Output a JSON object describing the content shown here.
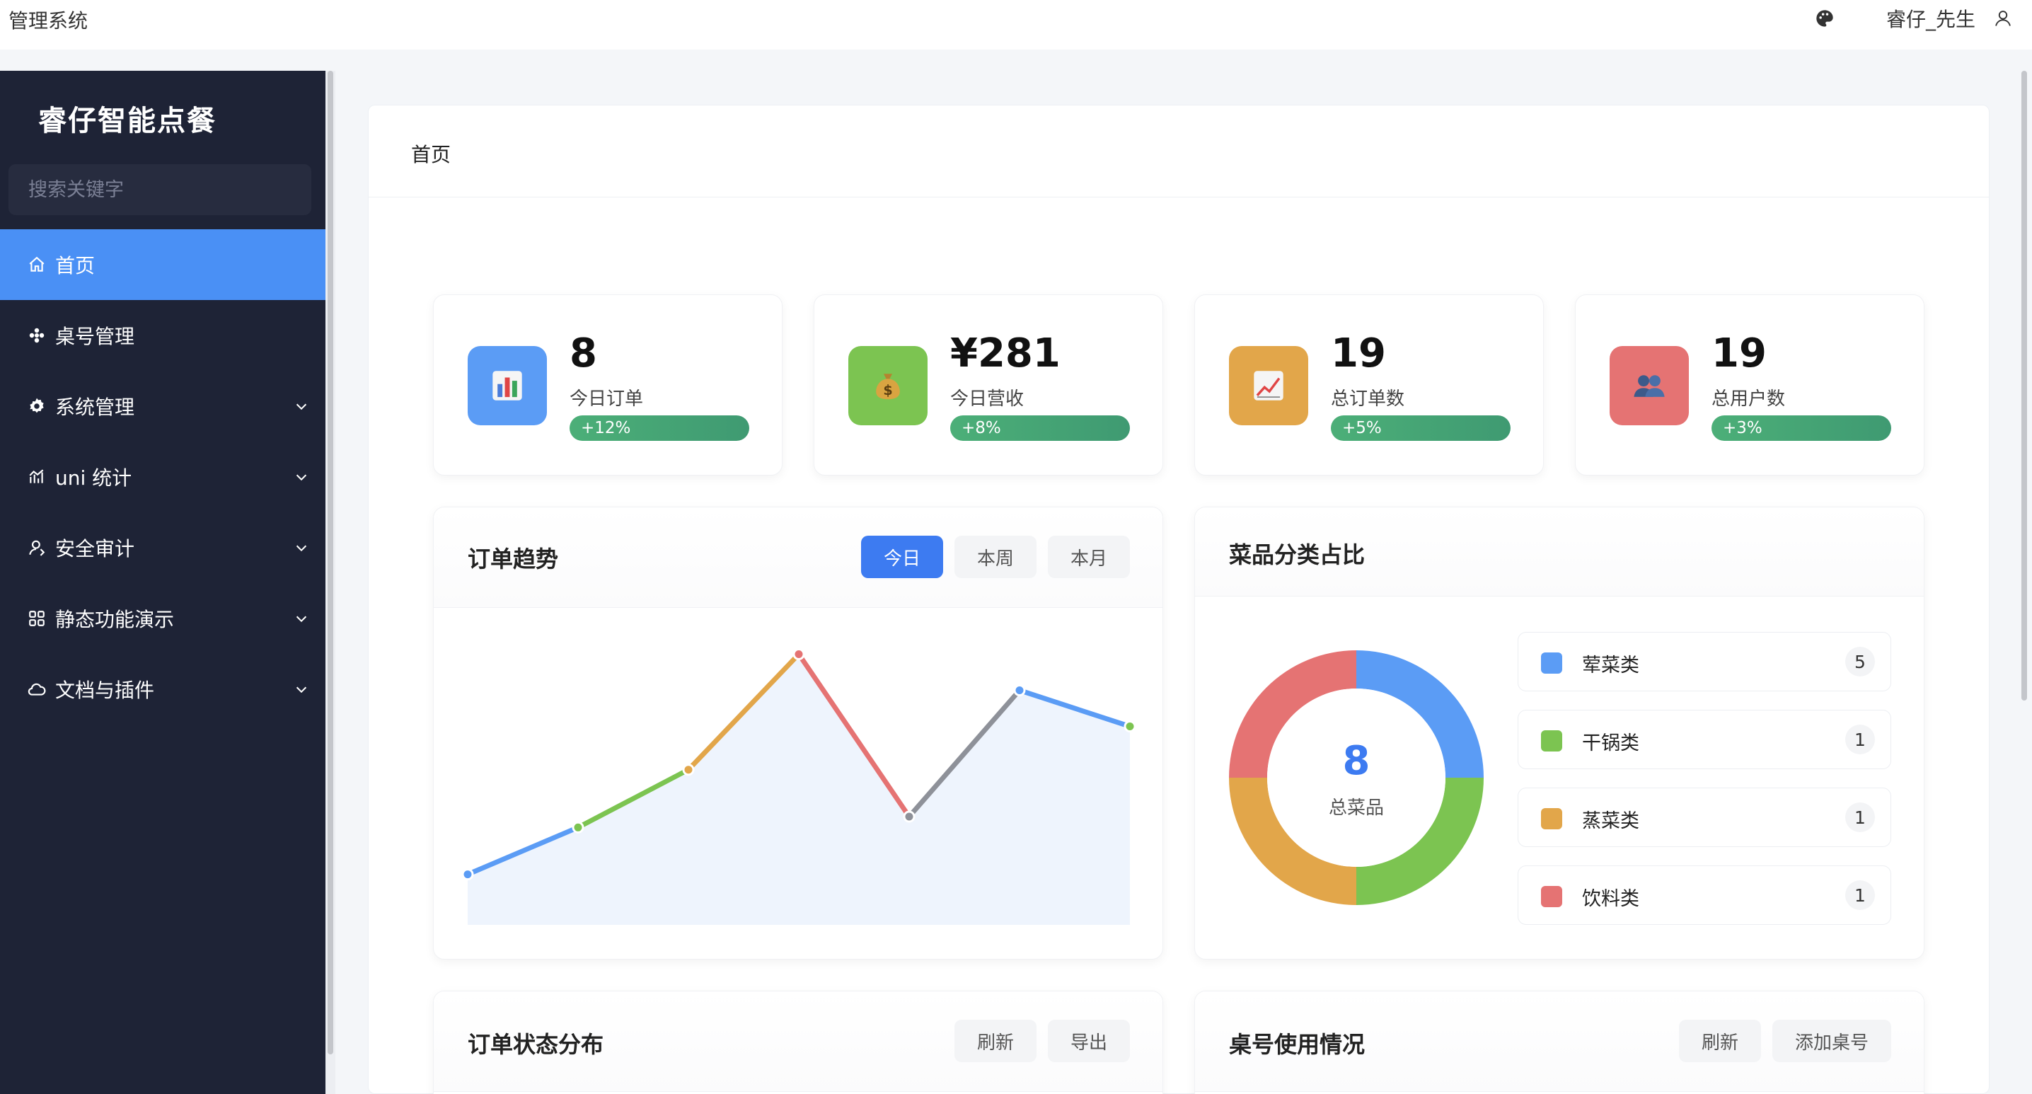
{
  "app": {
    "title": "管理系统",
    "user_name": "睿仔_先生"
  },
  "sidebar": {
    "brand": "睿仔智能点餐",
    "search_placeholder": "搜索关键字",
    "items": [
      {
        "label": "首页",
        "icon": "home-icon",
        "active": true
      },
      {
        "label": "桌号管理",
        "icon": "flower-icon"
      },
      {
        "label": "系统管理",
        "icon": "gear-icon",
        "expandable": true
      },
      {
        "label": "uni 统计",
        "icon": "chart-icon",
        "expandable": true
      },
      {
        "label": "安全审计",
        "icon": "user-icon",
        "expandable": true
      },
      {
        "label": "静态功能演示",
        "icon": "grid-icon",
        "expandable": true
      },
      {
        "label": "文档与插件",
        "icon": "cloud-icon",
        "expandable": true
      }
    ]
  },
  "page": {
    "breadcrumb": "首页"
  },
  "stats": [
    {
      "value": "8",
      "label": "今日订单",
      "trend": "+12%",
      "icon": "bar-chart-icon",
      "color": "#5b9cf5"
    },
    {
      "value": "¥281",
      "label": "今日营收",
      "trend": "+8%",
      "icon": "money-bag-icon",
      "color": "#7cc451"
    },
    {
      "value": "19",
      "label": "总订单数",
      "trend": "+5%",
      "icon": "trend-up-icon",
      "color": "#e2a64a"
    },
    {
      "value": "19",
      "label": "总用户数",
      "trend": "+3%",
      "icon": "users-icon",
      "color": "#e57373"
    }
  ],
  "order_trend": {
    "title": "订单趋势",
    "tabs": [
      "今日",
      "本周",
      "本月"
    ],
    "active_tab": 0
  },
  "category_share": {
    "title": "菜品分类占比",
    "center_value": "8",
    "center_label": "总菜品",
    "items": [
      {
        "name": "荤菜类",
        "count": "5",
        "color": "#5b9cf5"
      },
      {
        "name": "干锅类",
        "count": "1",
        "color": "#7cc451"
      },
      {
        "name": "蒸菜类",
        "count": "1",
        "color": "#e2a64a"
      },
      {
        "name": "饮料类",
        "count": "1",
        "color": "#e57373"
      }
    ]
  },
  "order_status": {
    "title": "订单状态分布",
    "refresh": "刷新",
    "export": "导出"
  },
  "table_usage": {
    "title": "桌号使用情况",
    "refresh": "刷新",
    "add": "添加桌号"
  },
  "chart_data": [
    {
      "type": "line",
      "x": [
        1,
        2,
        3,
        4,
        5,
        6,
        7
      ],
      "series": [
        {
          "values": [
            0.9,
            2.2,
            3.8,
            7.0,
            2.5,
            6.0,
            5.0
          ]
        }
      ],
      "segment_colors": [
        "#5b9cf5",
        "#7cc451",
        "#e2a64a",
        "#e57373",
        "#8e9199",
        "#5b9cf5"
      ],
      "point_colors": [
        "#5b9cf5",
        "#7cc451",
        "#e2a64a",
        "#e57373",
        "#8e9199",
        "#5b9cf5",
        "#7cc451"
      ],
      "area_fill": "#eef4fd",
      "ylim": [
        -0.5,
        7.5
      ],
      "grid": false
    },
    {
      "type": "pie",
      "categories": [
        "荤菜类",
        "干锅类",
        "蒸菜类",
        "饮料类"
      ],
      "values": [
        2,
        2,
        2,
        2
      ],
      "colors": [
        "#5b9cf5",
        "#7cc451",
        "#e2a64a",
        "#e57373"
      ],
      "donut": true
    }
  ]
}
